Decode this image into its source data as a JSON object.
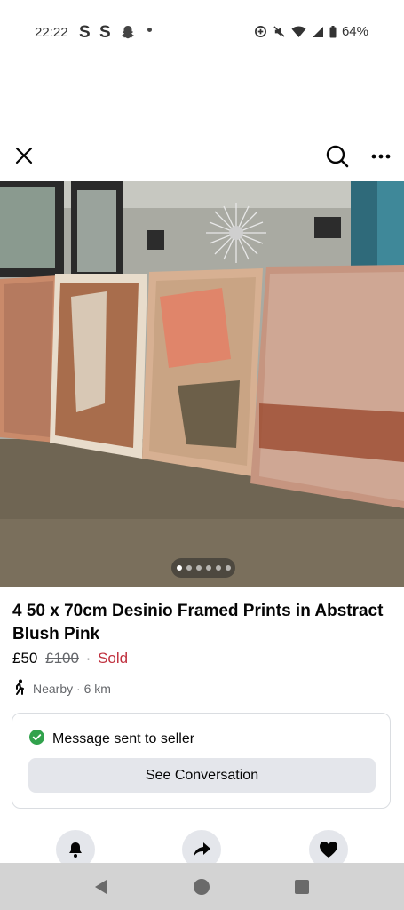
{
  "status_bar": {
    "time": "22:22",
    "notif_1": "S",
    "notif_2": "S",
    "battery": "64%"
  },
  "top_bar": {
    "close_icon": "close-icon",
    "search_icon": "search-icon",
    "more_icon": "more-icon"
  },
  "gallery": {
    "image_count": 6,
    "active_index": 0
  },
  "listing": {
    "title": "4 50 x 70cm Desinio Framed Prints in Abstract Blush Pink",
    "price": "£50",
    "original_price": "£100",
    "separator": "·",
    "status": "Sold",
    "location": "Nearby · 6 km"
  },
  "message": {
    "status_text": "Message sent to seller",
    "button_label": "See Conversation"
  },
  "actions": [
    "bell-icon",
    "share-icon",
    "heart-icon"
  ],
  "nav": [
    "back-icon",
    "home-icon",
    "recents-icon"
  ],
  "colors": {
    "sold": "#c0313f",
    "success": "#31a24c",
    "button_bg": "#e4e6eb",
    "nav_bg": "#d3d3d3"
  }
}
